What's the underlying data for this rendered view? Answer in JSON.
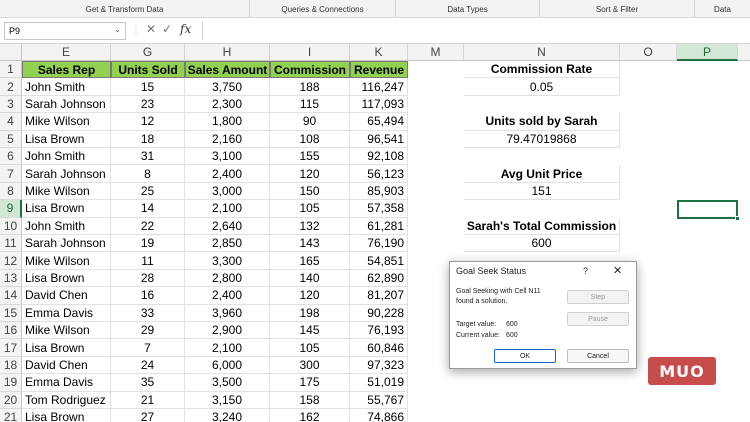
{
  "ribbon_groups": [
    "Get & Transform Data",
    "Queries & Connections",
    "Data Types",
    "Sort & Filter",
    "Data"
  ],
  "formula_bar": {
    "name_box": "P9",
    "fx": "fx",
    "value": ""
  },
  "columns": [
    "E",
    "G",
    "H",
    "I",
    "K",
    "M",
    "N",
    "O",
    "P"
  ],
  "selected_column": "P",
  "rows": [
    "1",
    "2",
    "3",
    "4",
    "5",
    "6",
    "7",
    "8",
    "9",
    "10",
    "11",
    "12",
    "13",
    "14",
    "15",
    "16",
    "17",
    "18",
    "19",
    "20",
    "21"
  ],
  "selected_row": "9",
  "table": {
    "headers": [
      "Sales Rep",
      "Units Sold",
      "Sales Amount",
      "Commission",
      "Revenue"
    ],
    "rows": [
      [
        "John Smith",
        "15",
        "3,750",
        "188",
        "116,247"
      ],
      [
        "Sarah Johnson",
        "23",
        "2,300",
        "115",
        "117,093"
      ],
      [
        "Mike Wilson",
        "12",
        "1,800",
        "90",
        "65,494"
      ],
      [
        "Lisa Brown",
        "18",
        "2,160",
        "108",
        "96,541"
      ],
      [
        "John Smith",
        "31",
        "3,100",
        "155",
        "92,108"
      ],
      [
        "Sarah Johnson",
        "8",
        "2,400",
        "120",
        "56,123"
      ],
      [
        "Mike Wilson",
        "25",
        "3,000",
        "150",
        "85,903"
      ],
      [
        "Lisa Brown",
        "14",
        "2,100",
        "105",
        "57,358"
      ],
      [
        "John Smith",
        "22",
        "2,640",
        "132",
        "61,281"
      ],
      [
        "Sarah Johnson",
        "19",
        "2,850",
        "143",
        "76,190"
      ],
      [
        "Mike Wilson",
        "11",
        "3,300",
        "165",
        "54,851"
      ],
      [
        "Lisa Brown",
        "28",
        "2,800",
        "140",
        "62,890"
      ],
      [
        "David Chen",
        "16",
        "2,400",
        "120",
        "81,207"
      ],
      [
        "Emma Davis",
        "33",
        "3,960",
        "198",
        "90,228"
      ],
      [
        "Mike Wilson",
        "29",
        "2,900",
        "145",
        "76,193"
      ],
      [
        "Lisa Brown",
        "7",
        "2,100",
        "105",
        "60,846"
      ],
      [
        "David Chen",
        "24",
        "6,000",
        "300",
        "97,323"
      ],
      [
        "Emma Davis",
        "35",
        "3,500",
        "175",
        "51,019"
      ],
      [
        "Tom Rodriguez",
        "21",
        "3,150",
        "158",
        "55,767"
      ],
      [
        "Lisa Brown",
        "27",
        "3,240",
        "162",
        "74,866"
      ]
    ]
  },
  "calc_panel": {
    "commission_rate_label": "Commission Rate",
    "commission_rate_value": "0.05",
    "units_sarah_label": "Units sold by Sarah",
    "units_sarah_value": "79.47019868",
    "avg_price_label": "Avg Unit Price",
    "avg_price_value": "151",
    "sarah_commission_label": "Sarah's Total Commission",
    "sarah_commission_value": "600"
  },
  "dialog": {
    "title": "Goal Seek Status",
    "help": "?",
    "close": "✕",
    "message_line1": "Goal Seeking with Cell N11",
    "message_line2": "found a solution.",
    "target_label": "Target value:",
    "target_value": "600",
    "current_label": "Current value:",
    "current_value": "600",
    "step_btn": "Step",
    "pause_btn": "Pause",
    "ok_btn": "OK",
    "cancel_btn": "Cancel"
  },
  "logo_text": "MUO",
  "colors": {
    "header_fill": "#92d050",
    "selection": "#1e7145",
    "logo": "#c23a3a"
  }
}
